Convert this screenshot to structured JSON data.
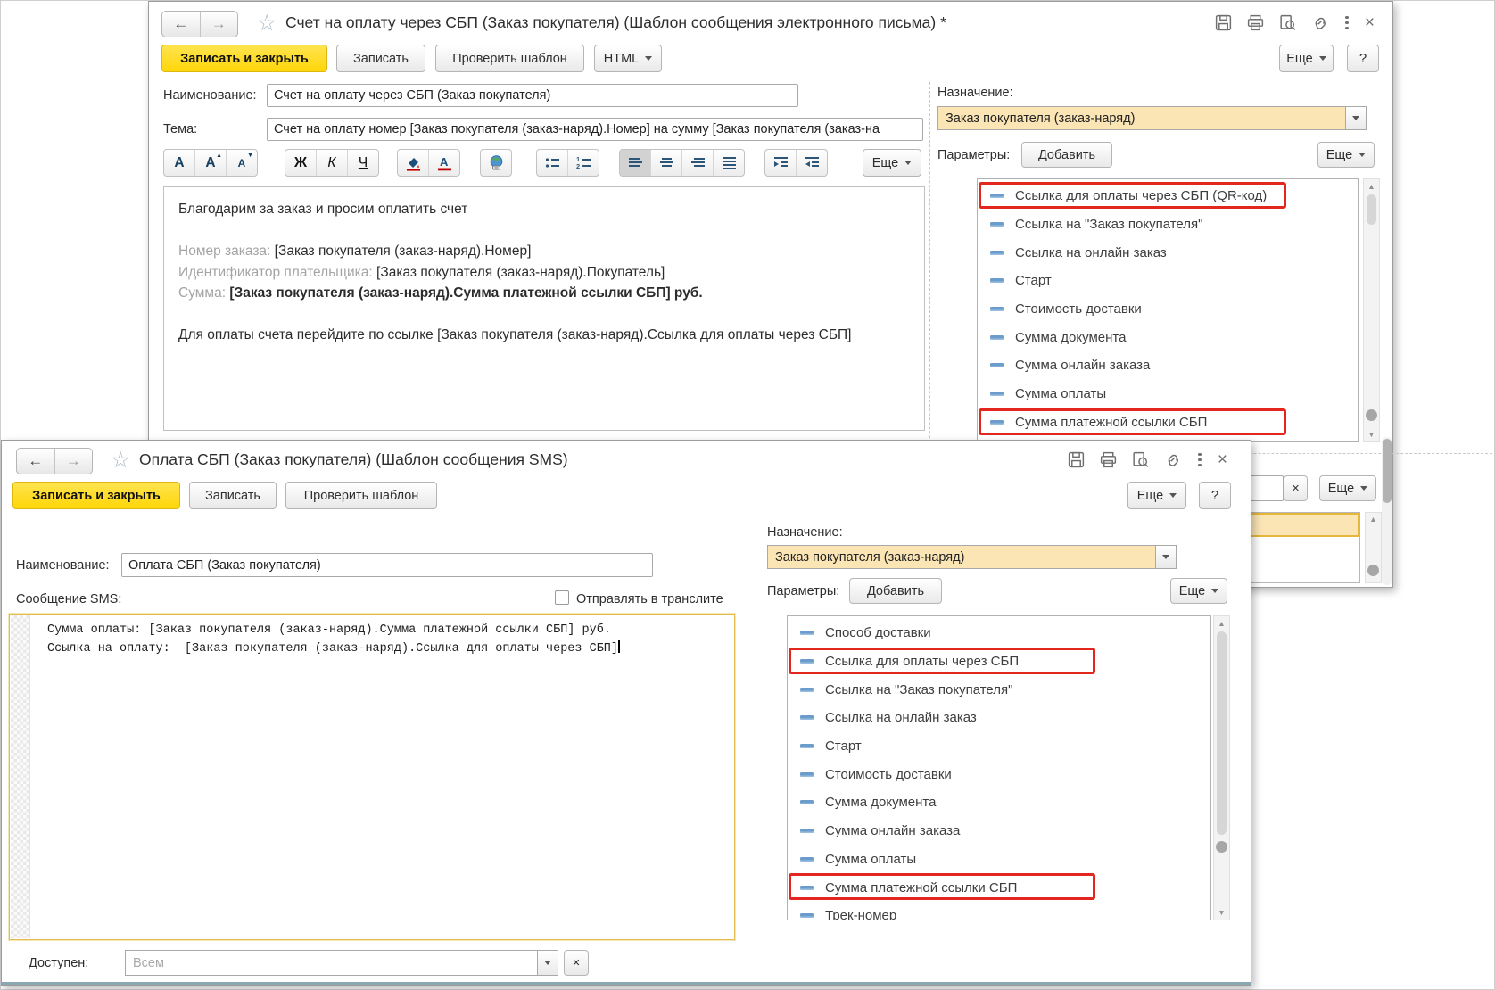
{
  "colors": {
    "primary_button": "#ffd608",
    "selected_value_bg": "#fbe5b5",
    "highlight_box": "#e3271e",
    "param_dash_icon": "#6b9ccc"
  },
  "email_window": {
    "title": "Счет на оплату через СБП (Заказ покупателя) (Шаблон сообщения электронного письма) *",
    "nav": {
      "back": "←",
      "forward": "→"
    },
    "titlebar_icons": [
      "save-icon",
      "print-icon",
      "preview-icon",
      "link-icon",
      "kebab-icon",
      "close-icon"
    ],
    "actions": {
      "save_close": "Записать и закрыть",
      "save": "Записать",
      "check": "Проверить шаблон",
      "html": "HTML",
      "more": "Еще",
      "help": "?"
    },
    "name_label": "Наименование:",
    "name_value": "Счет на оплату через СБП (Заказ покупателя)",
    "subject_label": "Тема:",
    "subject_value": "Счет на оплату номер [Заказ покупателя (заказ-наряд).Номер] на сумму [Заказ покупателя (заказ-на",
    "format_toolbar": {
      "font": "A",
      "bold": "Ж",
      "italic": "К",
      "underline": "Ч",
      "more": "Еще"
    },
    "body": {
      "intro": "Благодарим за заказ и просим оплатить счет",
      "rows": [
        {
          "label": "Номер заказа:",
          "value": "[Заказ покупателя (заказ-наряд).Номер]"
        },
        {
          "label": "Идентификатор плательщика:",
          "value": "[Заказ покупателя (заказ-наряд).Покупатель]"
        },
        {
          "label": "Сумма:",
          "value": "[Заказ покупателя (заказ-наряд).Сумма платежной ссылки СБП] руб."
        }
      ],
      "footer": "Для оплаты счета перейдите по ссылке [Заказ покупателя (заказ-наряд).Ссылка для оплаты через СБП]"
    },
    "right": {
      "purpose_label": "Назначение:",
      "purpose_value": "Заказ покупателя (заказ-наряд)",
      "params_label": "Параметры:",
      "add": "Добавить",
      "more": "Еще",
      "params": [
        {
          "label": "Ссылка для оплаты через СБП (QR-код)",
          "highlighted": true
        },
        {
          "label": "Ссылка на \"Заказ покупателя\"",
          "highlighted": false
        },
        {
          "label": "Ссылка на онлайн заказ",
          "highlighted": false
        },
        {
          "label": "Старт",
          "highlighted": false
        },
        {
          "label": "Стоимость доставки",
          "highlighted": false
        },
        {
          "label": "Сумма документа",
          "highlighted": false
        },
        {
          "label": "Сумма онлайн заказа",
          "highlighted": false
        },
        {
          "label": "Сумма оплаты",
          "highlighted": false
        },
        {
          "label": "Сумма платежной ссылки СБП",
          "highlighted": true
        }
      ]
    },
    "fragment": {
      "clear": "×",
      "more": "Еще"
    }
  },
  "sms_window": {
    "title": "Оплата СБП (Заказ покупателя) (Шаблон сообщения SMS)",
    "nav": {
      "back": "←",
      "forward": "→"
    },
    "titlebar_icons": [
      "save-icon",
      "print-icon",
      "preview-icon",
      "link-icon",
      "kebab-icon",
      "close-icon"
    ],
    "actions": {
      "save_close": "Записать и закрыть",
      "save": "Записать",
      "check": "Проверить шаблон",
      "more": "Еще",
      "help": "?"
    },
    "name_label": "Наименование:",
    "name_value": "Оплата СБП (Заказ покупателя)",
    "message_label": "Сообщение SMS:",
    "translit_label": "Отправлять в транслите",
    "message_lines": [
      "Сумма оплаты: [Заказ покупателя (заказ-наряд).Сумма платежной ссылки СБП] руб.",
      "Ссылка на оплату:  [Заказ покупателя (заказ-наряд).Ссылка для оплаты через СБП]"
    ],
    "available_label": "Доступен:",
    "available_placeholder": "Всем",
    "clear": "×",
    "right": {
      "purpose_label": "Назначение:",
      "purpose_value": "Заказ покупателя (заказ-наряд)",
      "params_label": "Параметры:",
      "add": "Добавить",
      "more": "Еще",
      "params": [
        {
          "label": "Способ доставки",
          "highlighted": false
        },
        {
          "label": "Ссылка для оплаты через СБП",
          "highlighted": true
        },
        {
          "label": "Ссылка на \"Заказ покупателя\"",
          "highlighted": false
        },
        {
          "label": "Ссылка на онлайн заказ",
          "highlighted": false
        },
        {
          "label": "Старт",
          "highlighted": false
        },
        {
          "label": "Стоимость доставки",
          "highlighted": false
        },
        {
          "label": "Сумма документа",
          "highlighted": false
        },
        {
          "label": "Сумма онлайн заказа",
          "highlighted": false
        },
        {
          "label": "Сумма оплаты",
          "highlighted": false
        },
        {
          "label": "Сумма платежной ссылки СБП",
          "highlighted": true
        },
        {
          "label": "Трек-номер",
          "highlighted": false
        }
      ]
    }
  }
}
